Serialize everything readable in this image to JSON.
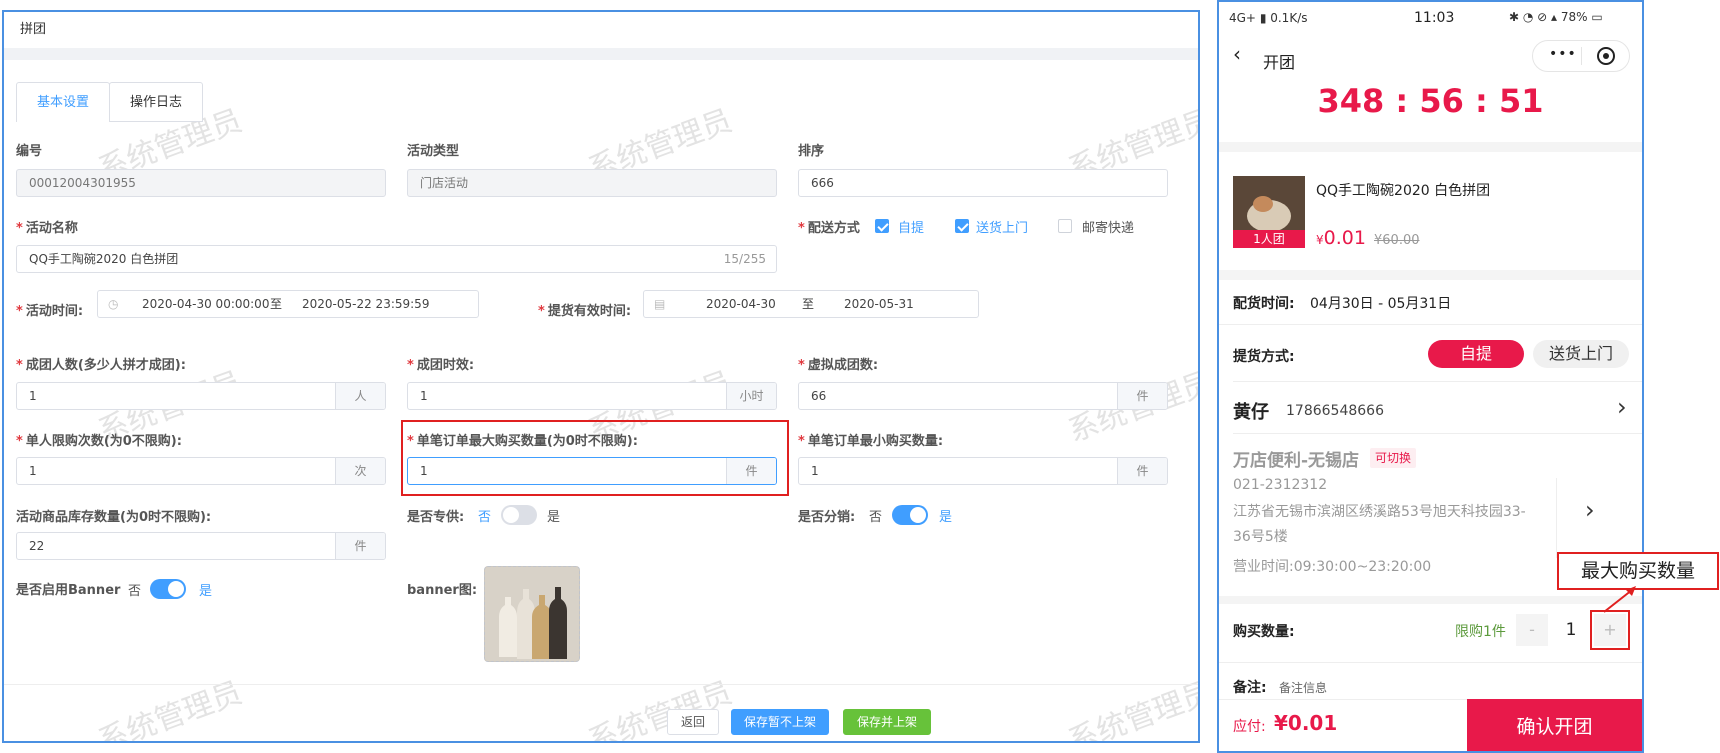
{
  "admin": {
    "page_title": "拼团",
    "watermark": "系统管理员",
    "tabs": [
      {
        "label": "基本设置"
      },
      {
        "label": "操作日志"
      }
    ],
    "fields": {
      "code": {
        "label": "编号",
        "value": "00012004301955"
      },
      "activity_type": {
        "label": "活动类型",
        "value": "门店活动"
      },
      "sort": {
        "label": "排序",
        "value": "666"
      },
      "activity_name": {
        "label": "活动名称",
        "value": "QQ手工陶碗2020 白色拼团",
        "count": "15/255"
      },
      "delivery": {
        "label": "配送方式",
        "options": [
          "自提",
          "送货上门",
          "邮寄快递"
        ],
        "checked": [
          true,
          true,
          false
        ]
      },
      "activity_time": {
        "label": "活动时间:",
        "start": "2020-04-30 00:00:00",
        "sep": "至",
        "end": "2020-05-22 23:59:59"
      },
      "pickup_time": {
        "label": "提货有效时间:",
        "start": "2020-04-30",
        "sep": "至",
        "end": "2020-05-31"
      },
      "group_size": {
        "label": "成团人数(多少人拼才成团):",
        "value": "1",
        "unit": "人"
      },
      "group_duration": {
        "label": "成团时效:",
        "value": "1",
        "unit": "小时"
      },
      "virtual_groups": {
        "label": "虚拟成团数:",
        "value": "66",
        "unit": "件"
      },
      "per_user_limit": {
        "label": "单人限购次数(为0不限购):",
        "value": "1",
        "unit": "次"
      },
      "max_per_order": {
        "label": "单笔订单最大购买数量(为0时不限购):",
        "value": "1",
        "unit": "件"
      },
      "min_per_order": {
        "label": "单笔订单最小购买数量:",
        "value": "1",
        "unit": "件"
      },
      "stock": {
        "label": "活动商品库存数量(为0时不限购):",
        "value": "22",
        "unit": "件"
      },
      "exclusive": {
        "label": "是否专供:",
        "off": "否",
        "on": "是",
        "enabled": false
      },
      "distribution": {
        "label": "是否分销:",
        "off": "否",
        "on": "是",
        "enabled": true
      },
      "banner_enabled": {
        "label": "是否启用Banner",
        "off": "否",
        "on": "是",
        "enabled": true
      },
      "banner_image": {
        "label": "banner图:"
      }
    },
    "buttons": {
      "back": "返回",
      "save_draft": "保存暂不上架",
      "save_publish": "保存并上架"
    }
  },
  "phone": {
    "status": {
      "network": "4G+",
      "speed": "0.1K/s",
      "time": "11:03",
      "battery": "78%"
    },
    "nav_title": "开团",
    "countdown": {
      "h": "348",
      "m": "56",
      "s": "51",
      "sep": ":"
    },
    "product": {
      "name": "QQ手工陶碗2020 白色拼团",
      "badge": "1人团",
      "currency": "¥",
      "price": "0.01",
      "orig_price": "¥60.00"
    },
    "delivery_time": {
      "label": "配货时间:",
      "value": "04月30日 - 05月31日"
    },
    "pickup_method": {
      "label": "提货方式:",
      "options": [
        "自提",
        "送货上门"
      ]
    },
    "contact": {
      "name": "黄仔",
      "phone": "17866548666"
    },
    "store": {
      "name": "万店便利-无锡店",
      "tag": "可切换",
      "tel": "021-2312312",
      "address": "江苏省无锡市滨湖区绣溪路53号旭天科技园33-36号5楼",
      "hours": "营业时间:09:30:00~23:20:00"
    },
    "quantity": {
      "label": "购买数量:",
      "limit": "限购1件",
      "minus": "-",
      "value": "1",
      "plus": "+"
    },
    "remark": {
      "label": "备注:",
      "placeholder": "备注信息"
    },
    "footer": {
      "label": "应付:",
      "currency": "¥",
      "amount": "0.01",
      "confirm": "确认开团"
    }
  },
  "annotation": {
    "label": "最大购买数量",
    "color": "#e02020"
  }
}
